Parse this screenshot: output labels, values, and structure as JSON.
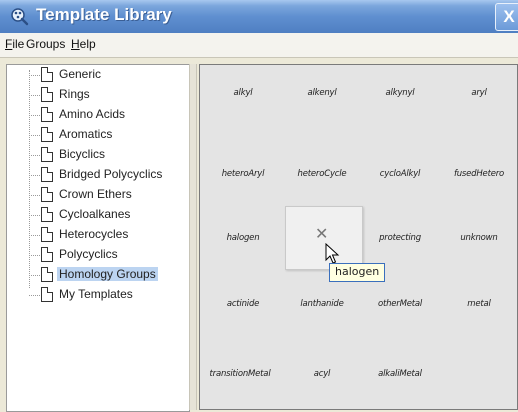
{
  "window": {
    "title": "Template Library",
    "close_glyph": "X"
  },
  "menu": [
    {
      "mnemonic": "F",
      "rest": "ile"
    },
    {
      "mnemonic": "",
      "rest": "Groups"
    },
    {
      "mnemonic": "H",
      "rest": "elp"
    }
  ],
  "tree": {
    "items": [
      "Generic",
      "Rings",
      "Amino Acids",
      "Aromatics",
      "Bicyclics",
      "Bridged Polycyclics",
      "Crown Ethers",
      "Cycloalkanes",
      "Heterocycles",
      "Polycyclics",
      "Homology Groups",
      "My Templates"
    ],
    "selected_label": "Homology Groups"
  },
  "templates": {
    "cells": [
      "alkyl",
      "alkenyl",
      "alkynyl",
      "aryl",
      "heteroAryl",
      "heteroCycle",
      "cycloAlkyl",
      "fusedHetero",
      "halogen",
      "",
      "protecting",
      "unknown",
      "actinide",
      "lanthanide",
      "otherMetal",
      "metal",
      "transitionMetal",
      "acyl",
      "alkaliMetal"
    ],
    "hover_glyph": "✕",
    "tooltip": "halogen"
  },
  "colors": {
    "title_gradient_bottom": "#4f7fc2",
    "selection": "#bcd4f1",
    "tooltip_bg": "#ffffe1"
  },
  "icons": {
    "title": "template-library-icon",
    "tree_item": "document-icon",
    "cursor": "mouse-pointer-icon"
  }
}
